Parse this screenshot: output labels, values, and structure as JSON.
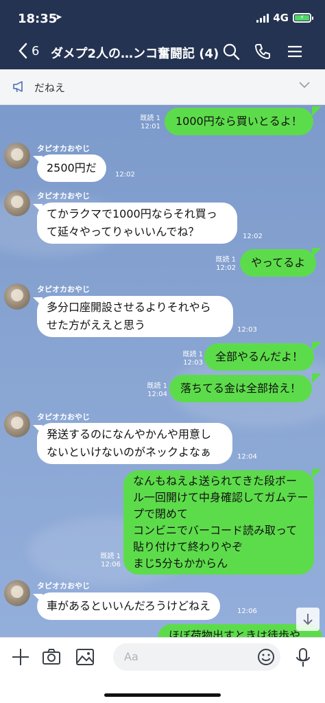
{
  "status": {
    "time": "18:35",
    "network": "4G"
  },
  "header": {
    "back_count": "6",
    "title": "ダメプ2人の…ンコ奮闘記 (4)"
  },
  "notice": {
    "text": "だねえ"
  },
  "sender_name": "タピオカおやじ",
  "messages": [
    {
      "dir": "out",
      "text": "1000円なら買いとるよ！",
      "read": "既読 1",
      "time": "12:01"
    },
    {
      "dir": "in",
      "text": "2500円だ",
      "time": "12:02"
    },
    {
      "dir": "in",
      "line1": "てかラクマで1000円ならそれ買っ",
      "line2": "て延々やってりゃいいんでね？",
      "time": "12:02"
    },
    {
      "dir": "out",
      "text": "やってるよ",
      "read": "既読 1",
      "time": "12:02"
    },
    {
      "dir": "in",
      "line1": "多分口座開設させるよりそれやら",
      "line2": "せた方がええと思う",
      "time": "12:03"
    },
    {
      "dir": "out",
      "text": "全部やるんだよ！",
      "read": "既読 1",
      "time": "12:03"
    },
    {
      "dir": "out",
      "text": "落ちてる金は全部拾え！",
      "read": "既読 1",
      "time": "12:04"
    },
    {
      "dir": "in",
      "line1": "発送するのになんやかんや用意し",
      "line2": "ないといけないのがネックよなぁ",
      "time": "12:04"
    },
    {
      "dir": "out",
      "line1": "なんもねえよ送られてきた段ボー",
      "line2": "ル一回開けて中身確認してガムテー",
      "line3": "プで閉めて",
      "line4": "コンビニでバーコード読み取って",
      "line5": "貼り付けて終わりやぞ",
      "line6": "まじ5分もかからん",
      "read": "既読 1",
      "time": "12:06"
    },
    {
      "dir": "in",
      "text": "車があるといいんだろうけどねえ",
      "time": "12:06"
    },
    {
      "dir": "out",
      "text": "ほぼ荷物出すときは徒歩や"
    }
  ],
  "input": {
    "placeholder": "Aa"
  },
  "icons": {
    "back": "chevron-left-icon",
    "search": "search-icon",
    "call": "phone-icon",
    "menu": "hamburger-menu-icon",
    "notice": "megaphone-icon",
    "expand": "chevron-down-icon",
    "plus": "plus-icon",
    "camera": "camera-icon",
    "image": "image-icon",
    "emoji": "emoji-icon",
    "mic": "microphone-icon",
    "scroll": "arrow-down-icon"
  },
  "colors": {
    "header": "#243352",
    "bubble_out": "#5ddc4b",
    "chat_bg": "#8aa6d3"
  }
}
